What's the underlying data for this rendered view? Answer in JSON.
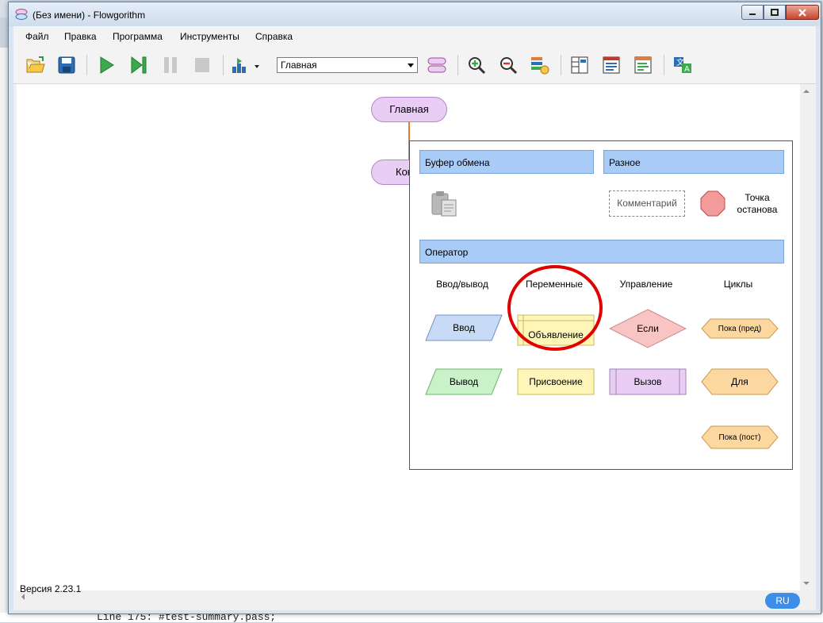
{
  "window": {
    "title": "(Без имени) - Flowgorithm"
  },
  "menu": [
    "Файл",
    "Правка",
    "Программа",
    "Инструменты",
    "Справка"
  ],
  "toolbar": {
    "function_select": "Главная"
  },
  "canvas": {
    "start_node": "Главная",
    "end_node": "Кон"
  },
  "popup": {
    "clipboard_header": "Буфер обмена",
    "misc_header": "Разное",
    "comment": "Комментарий",
    "breakpoint": "Точка останова",
    "operator_header": "Оператор",
    "columns": [
      "Ввод/вывод",
      "Переменные",
      "Управление",
      "Циклы"
    ],
    "io": {
      "input": "Ввод",
      "output": "Вывод"
    },
    "vars": {
      "declare": "Объявление",
      "assign": "Присвоение"
    },
    "control": {
      "if": "Если",
      "call": "Вызов"
    },
    "loops": {
      "while": "Пока (пред)",
      "for": "Для",
      "do": "Пока (пост)"
    }
  },
  "status": {
    "version": "Версия 2.23.1",
    "language": "RU"
  },
  "background": {
    "code_line": "Line 175: #test-summary.pass;"
  },
  "colors": {
    "terminal_fill": "#e9cdf5",
    "section_header": "#a9cbf7",
    "highlight": "#e00000",
    "lang_badge": "#3c8ee8"
  }
}
